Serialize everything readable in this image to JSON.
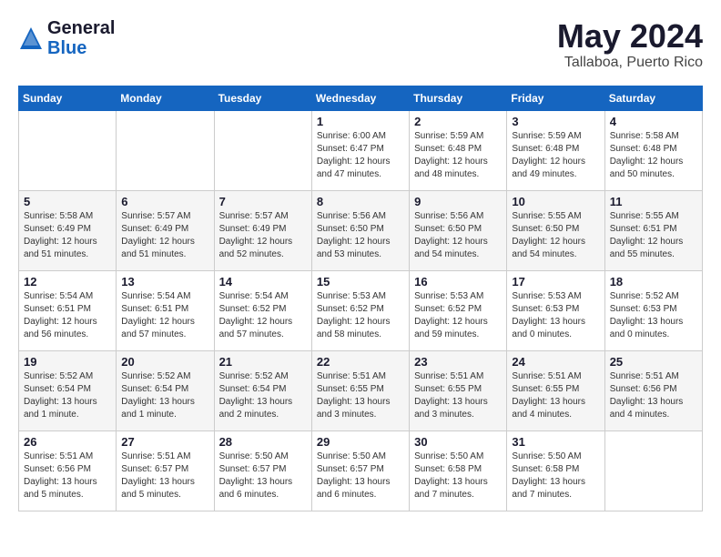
{
  "app": {
    "name_general": "General",
    "name_blue": "Blue"
  },
  "header": {
    "month": "May 2024",
    "location": "Tallaboa, Puerto Rico"
  },
  "weekdays": [
    "Sunday",
    "Monday",
    "Tuesday",
    "Wednesday",
    "Thursday",
    "Friday",
    "Saturday"
  ],
  "weeks": [
    {
      "days": [
        {
          "num": "",
          "info": ""
        },
        {
          "num": "",
          "info": ""
        },
        {
          "num": "",
          "info": ""
        },
        {
          "num": "1",
          "info": "Sunrise: 6:00 AM\nSunset: 6:47 PM\nDaylight: 12 hours\nand 47 minutes."
        },
        {
          "num": "2",
          "info": "Sunrise: 5:59 AM\nSunset: 6:48 PM\nDaylight: 12 hours\nand 48 minutes."
        },
        {
          "num": "3",
          "info": "Sunrise: 5:59 AM\nSunset: 6:48 PM\nDaylight: 12 hours\nand 49 minutes."
        },
        {
          "num": "4",
          "info": "Sunrise: 5:58 AM\nSunset: 6:48 PM\nDaylight: 12 hours\nand 50 minutes."
        }
      ]
    },
    {
      "days": [
        {
          "num": "5",
          "info": "Sunrise: 5:58 AM\nSunset: 6:49 PM\nDaylight: 12 hours\nand 51 minutes."
        },
        {
          "num": "6",
          "info": "Sunrise: 5:57 AM\nSunset: 6:49 PM\nDaylight: 12 hours\nand 51 minutes."
        },
        {
          "num": "7",
          "info": "Sunrise: 5:57 AM\nSunset: 6:49 PM\nDaylight: 12 hours\nand 52 minutes."
        },
        {
          "num": "8",
          "info": "Sunrise: 5:56 AM\nSunset: 6:50 PM\nDaylight: 12 hours\nand 53 minutes."
        },
        {
          "num": "9",
          "info": "Sunrise: 5:56 AM\nSunset: 6:50 PM\nDaylight: 12 hours\nand 54 minutes."
        },
        {
          "num": "10",
          "info": "Sunrise: 5:55 AM\nSunset: 6:50 PM\nDaylight: 12 hours\nand 54 minutes."
        },
        {
          "num": "11",
          "info": "Sunrise: 5:55 AM\nSunset: 6:51 PM\nDaylight: 12 hours\nand 55 minutes."
        }
      ]
    },
    {
      "days": [
        {
          "num": "12",
          "info": "Sunrise: 5:54 AM\nSunset: 6:51 PM\nDaylight: 12 hours\nand 56 minutes."
        },
        {
          "num": "13",
          "info": "Sunrise: 5:54 AM\nSunset: 6:51 PM\nDaylight: 12 hours\nand 57 minutes."
        },
        {
          "num": "14",
          "info": "Sunrise: 5:54 AM\nSunset: 6:52 PM\nDaylight: 12 hours\nand 57 minutes."
        },
        {
          "num": "15",
          "info": "Sunrise: 5:53 AM\nSunset: 6:52 PM\nDaylight: 12 hours\nand 58 minutes."
        },
        {
          "num": "16",
          "info": "Sunrise: 5:53 AM\nSunset: 6:52 PM\nDaylight: 12 hours\nand 59 minutes."
        },
        {
          "num": "17",
          "info": "Sunrise: 5:53 AM\nSunset: 6:53 PM\nDaylight: 13 hours\nand 0 minutes."
        },
        {
          "num": "18",
          "info": "Sunrise: 5:52 AM\nSunset: 6:53 PM\nDaylight: 13 hours\nand 0 minutes."
        }
      ]
    },
    {
      "days": [
        {
          "num": "19",
          "info": "Sunrise: 5:52 AM\nSunset: 6:54 PM\nDaylight: 13 hours\nand 1 minute."
        },
        {
          "num": "20",
          "info": "Sunrise: 5:52 AM\nSunset: 6:54 PM\nDaylight: 13 hours\nand 1 minute."
        },
        {
          "num": "21",
          "info": "Sunrise: 5:52 AM\nSunset: 6:54 PM\nDaylight: 13 hours\nand 2 minutes."
        },
        {
          "num": "22",
          "info": "Sunrise: 5:51 AM\nSunset: 6:55 PM\nDaylight: 13 hours\nand 3 minutes."
        },
        {
          "num": "23",
          "info": "Sunrise: 5:51 AM\nSunset: 6:55 PM\nDaylight: 13 hours\nand 3 minutes."
        },
        {
          "num": "24",
          "info": "Sunrise: 5:51 AM\nSunset: 6:55 PM\nDaylight: 13 hours\nand 4 minutes."
        },
        {
          "num": "25",
          "info": "Sunrise: 5:51 AM\nSunset: 6:56 PM\nDaylight: 13 hours\nand 4 minutes."
        }
      ]
    },
    {
      "days": [
        {
          "num": "26",
          "info": "Sunrise: 5:51 AM\nSunset: 6:56 PM\nDaylight: 13 hours\nand 5 minutes."
        },
        {
          "num": "27",
          "info": "Sunrise: 5:51 AM\nSunset: 6:57 PM\nDaylight: 13 hours\nand 5 minutes."
        },
        {
          "num": "28",
          "info": "Sunrise: 5:50 AM\nSunset: 6:57 PM\nDaylight: 13 hours\nand 6 minutes."
        },
        {
          "num": "29",
          "info": "Sunrise: 5:50 AM\nSunset: 6:57 PM\nDaylight: 13 hours\nand 6 minutes."
        },
        {
          "num": "30",
          "info": "Sunrise: 5:50 AM\nSunset: 6:58 PM\nDaylight: 13 hours\nand 7 minutes."
        },
        {
          "num": "31",
          "info": "Sunrise: 5:50 AM\nSunset: 6:58 PM\nDaylight: 13 hours\nand 7 minutes."
        },
        {
          "num": "",
          "info": ""
        }
      ]
    }
  ]
}
